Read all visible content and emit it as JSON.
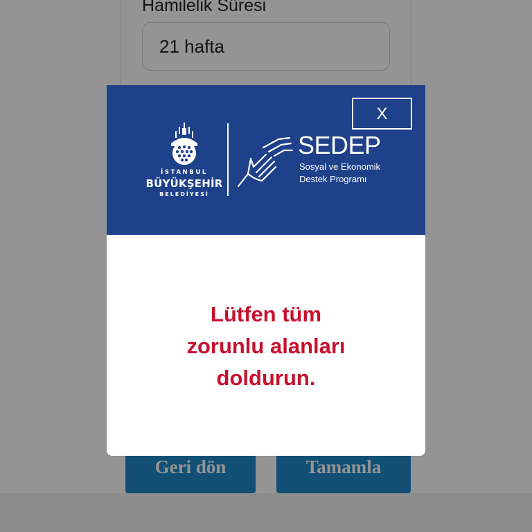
{
  "form": {
    "field_label": "Hamilelik Süresi",
    "field_value": "21 hafta"
  },
  "buttons": {
    "back_label": "Geri dön",
    "complete_label": "Tamamla"
  },
  "modal": {
    "close_label": "X",
    "brand": {
      "ibb_line1": "İSTANBUL",
      "ibb_line2": "BÜYÜKŞEHİR",
      "ibb_line3": "BELEDİYESİ",
      "program_title": "SEDEP",
      "program_subtitle_line1": "Sosyal ve Ekonomik",
      "program_subtitle_line2": "Destek Programı"
    },
    "message_lines": [
      "Lütfen tüm",
      "zorunlu alanları",
      "doldurun."
    ]
  },
  "colors": {
    "header_blue": "#1e418a",
    "error_red": "#c8102e",
    "button_blue": "#1e88c9"
  },
  "icons": [
    "close-icon",
    "ibb-emblem-icon",
    "helping-hands-icon"
  ]
}
